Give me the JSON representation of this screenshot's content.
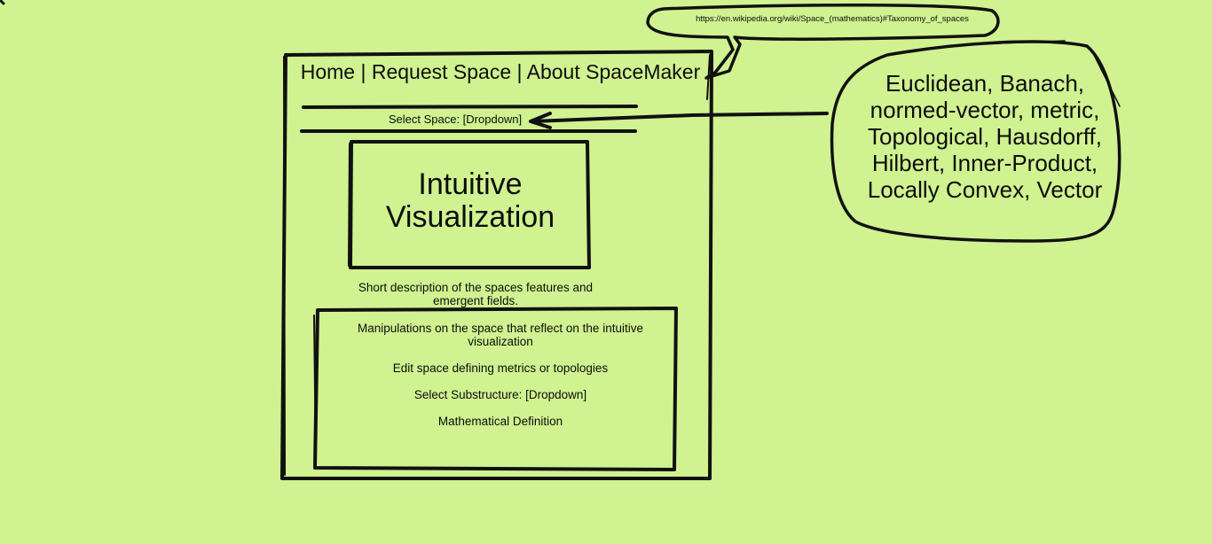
{
  "nav": {
    "text": "Home | Request Space | About SpaceMaker"
  },
  "select_space": {
    "label": "Select Space: [Dropdown]"
  },
  "visualization": {
    "label": "Intuitive Visualization"
  },
  "description": {
    "text": "Short description of the spaces features and emergent fields."
  },
  "manipulations": {
    "heading": "Manipulations on the space that reflect on the intuitive visualization",
    "edit": "Edit space defining metrics or topologies",
    "substructure": "Select Substructure: [Dropdown]",
    "definition": "Mathematical Definition"
  },
  "callout_url": {
    "text": "https://en.wikipedia.org/wiki/Space_(mathematics)#Taxonomy_of_spaces"
  },
  "callout_types": {
    "text": "Euclidean, Banach, normed-vector, metric, Topological, Hausdorff, Hilbert, Inner-Product, Locally Convex, Vector"
  },
  "colors": {
    "background": "#d0f290",
    "ink": "#111111"
  }
}
